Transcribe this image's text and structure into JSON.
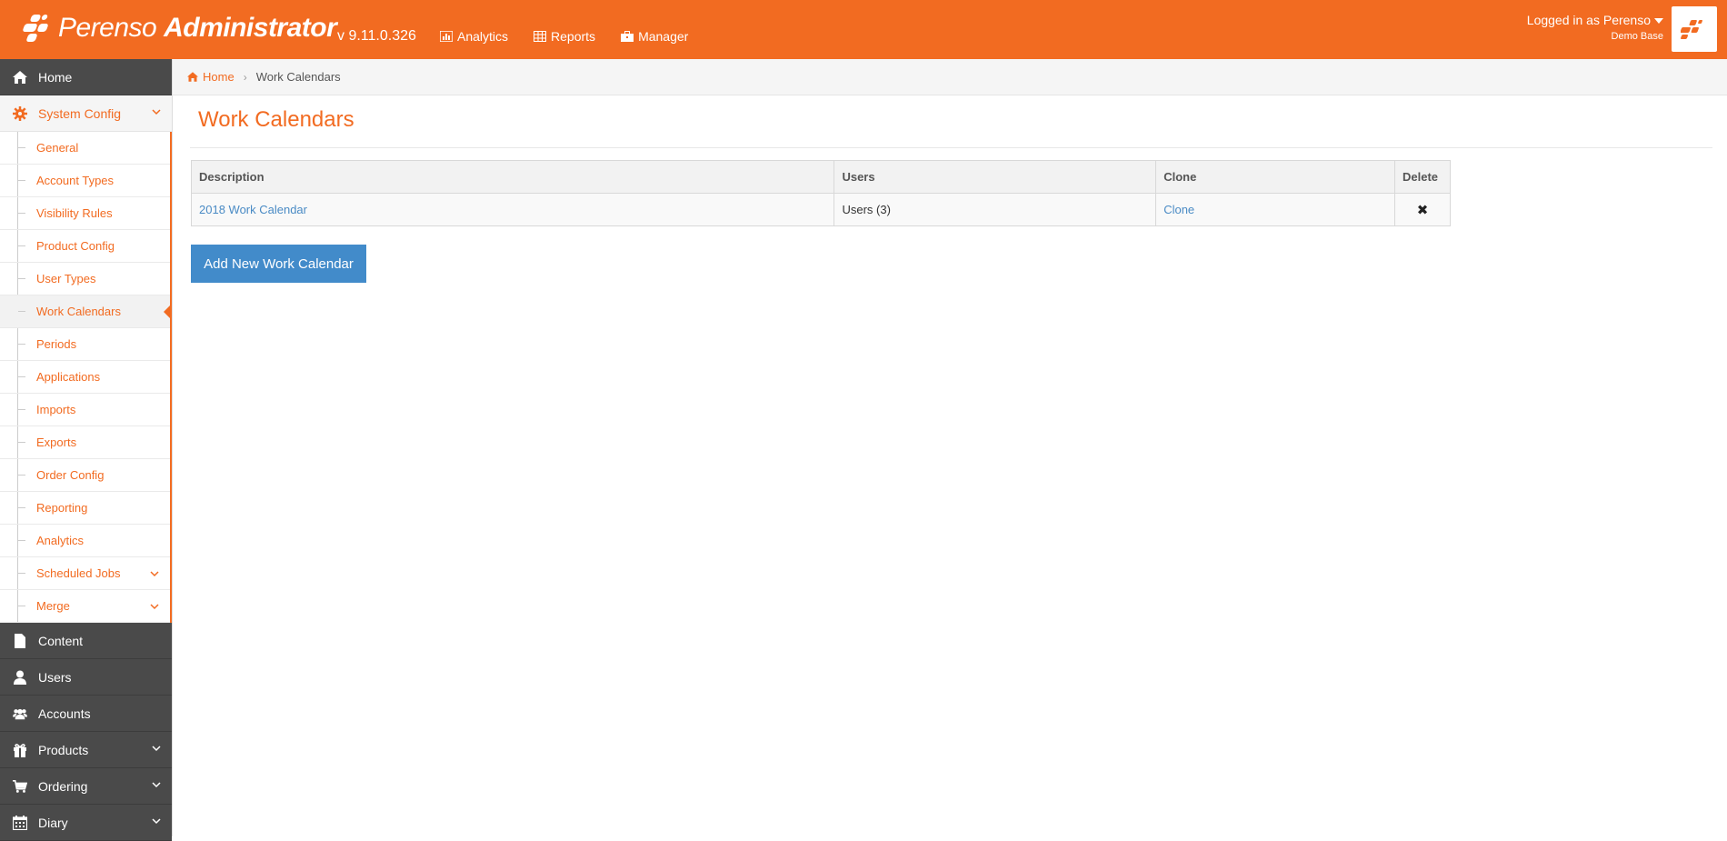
{
  "header": {
    "logo_light": "Perenso",
    "logo_bold": "Administrator",
    "version": "v 9.11.0.326",
    "nav": [
      {
        "label": "Analytics",
        "icon": "bar-chart-icon"
      },
      {
        "label": "Reports",
        "icon": "table-icon"
      },
      {
        "label": "Manager",
        "icon": "briefcase-icon"
      }
    ],
    "logged_in": "Logged in as Perenso",
    "base": "Demo Base",
    "brand_color": "#f26b21"
  },
  "sidebar": {
    "home": "Home",
    "system_config": "System Config",
    "sub_items": [
      "General",
      "Account Types",
      "Visibility Rules",
      "Product Config",
      "User Types",
      "Work Calendars",
      "Periods",
      "Applications",
      "Imports",
      "Exports",
      "Order Config",
      "Reporting",
      "Analytics",
      "Scheduled Jobs",
      "Merge"
    ],
    "bottom_items": [
      "Content",
      "Users",
      "Accounts",
      "Products",
      "Ordering",
      "Diary"
    ]
  },
  "breadcrumb": {
    "home": "Home",
    "current": "Work Calendars"
  },
  "main": {
    "title": "Work Calendars",
    "table": {
      "headers": [
        "Description",
        "Users",
        "Clone",
        "Delete"
      ],
      "rows": [
        {
          "description": "2018 Work Calendar",
          "users": "Users (3)",
          "clone": "Clone",
          "delete": "✖"
        }
      ]
    },
    "add_button": "Add New Work Calendar"
  }
}
